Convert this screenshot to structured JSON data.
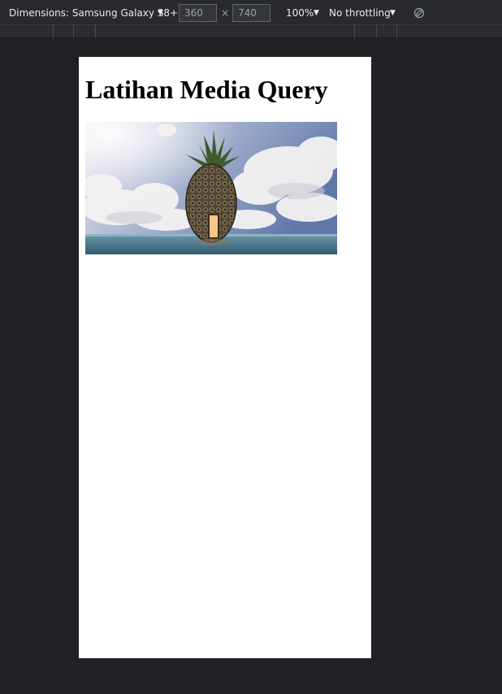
{
  "toolbar": {
    "dimensions_label": "Dimensions: Samsung Galaxy S8+",
    "width_value": "360",
    "height_value": "740",
    "times_symbol": "×",
    "zoom": "100%",
    "throttling": "No throttling",
    "caret": "▼",
    "rotate_icon": "rotate-icon"
  },
  "page": {
    "title": "Latihan Media Query",
    "image_icon": "pineapple-house-photo"
  },
  "colors": {
    "devtools_bg": "#202124",
    "toolbar_bg": "#292a2d",
    "page_bg": "#ffffff"
  }
}
